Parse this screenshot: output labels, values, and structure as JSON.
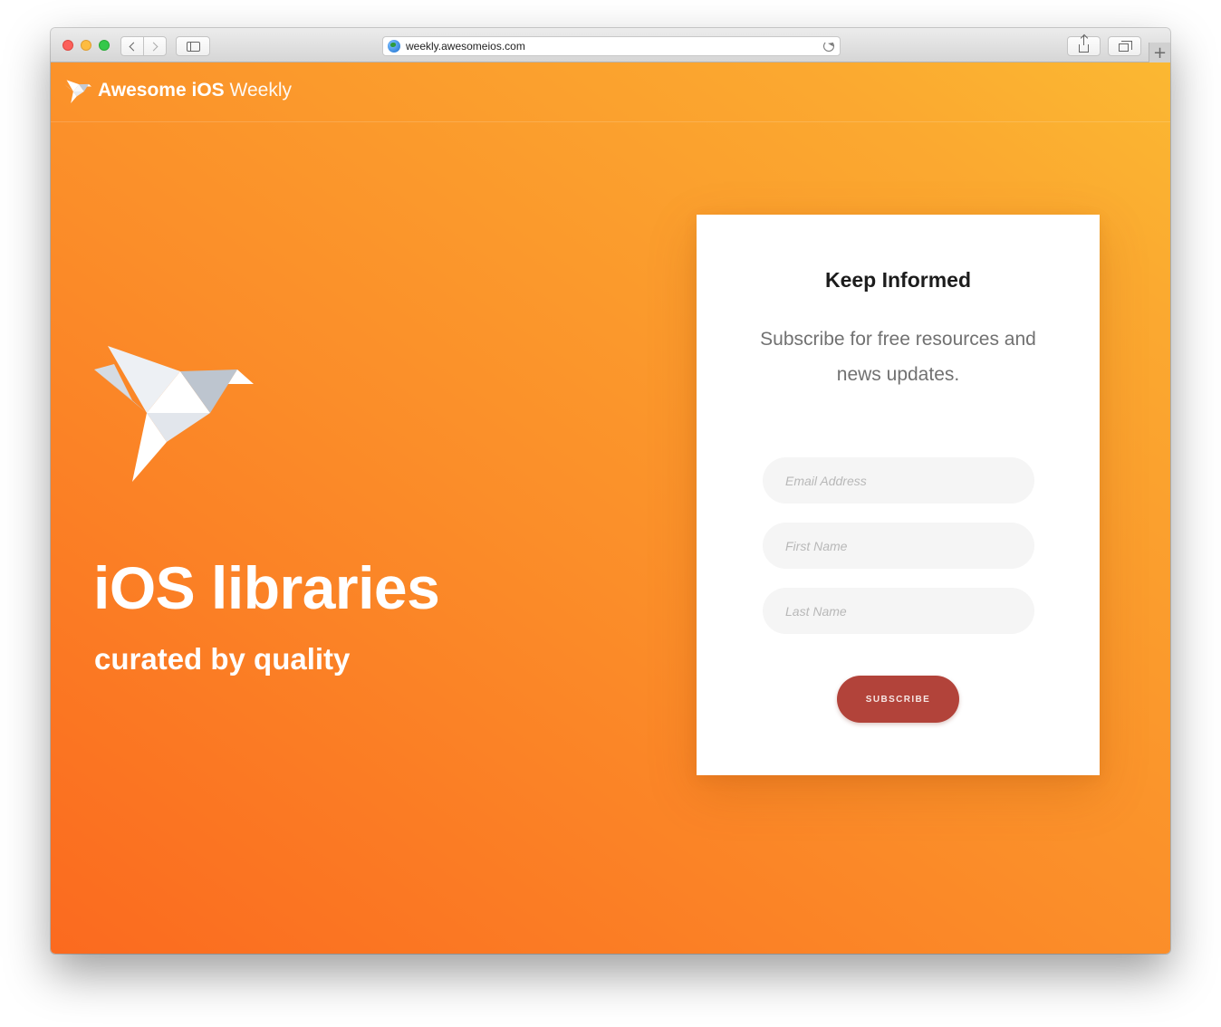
{
  "browser": {
    "url": "weekly.awesomeios.com",
    "new_tab_symbol": "+"
  },
  "site_nav": {
    "brand_bold": "Awesome iOS",
    "brand_light": "Weekly"
  },
  "hero": {
    "title": "iOS libraries",
    "subtitle": "curated by quality"
  },
  "subscribe_card": {
    "title": "Keep Informed",
    "description": "Subscribe for free resources and news updates.",
    "email_placeholder": "Email Address",
    "first_name_placeholder": "First Name",
    "last_name_placeholder": "Last Name",
    "button_label": "SUBSCRIBE"
  },
  "colors": {
    "gradient_start": "#fb6a1f",
    "gradient_end": "#fbb832",
    "button": "#b2433a"
  },
  "icons": [
    "origami-bird-logo-icon",
    "globe-icon",
    "reload-icon",
    "back-chevron-icon",
    "forward-chevron-icon",
    "sidebar-icon",
    "share-icon",
    "tabs-icon"
  ]
}
